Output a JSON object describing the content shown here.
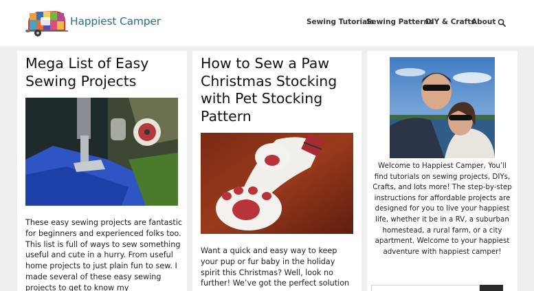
{
  "site": {
    "title": "Happiest Camper"
  },
  "nav": {
    "items": [
      "Sewing Tutorials",
      "Sewing Patterns",
      "DIY & Crafts",
      "About"
    ],
    "search_icon": "search-icon"
  },
  "posts": [
    {
      "title": "Mega List of Easy Sewing Projects",
      "excerpt": "These easy sewing projects are fantastic for beginners and experienced folks too. This list is full of ways to sew something useful and cute in a hurry. From useful home projects to just plain fun to sew. I made several of these easy sewing projects to get to know my"
    },
    {
      "title": "How to Sew a Paw Christmas Stocking with Pet Stocking Pattern",
      "excerpt": "Want a quick and easy way to keep your pup or fur baby in the holiday spirit this Christmas? Well, look no further! We’ve got the perfect solution"
    }
  ],
  "sidebar": {
    "bio": "Welcome to Happiest Camper, You’ll find tutorials on sewing projects, DIYs, Crafts, and lots more! The step-by-step instructions for affordable projects are designed for you to live your happiest life, whether it be in a RV, a suburban homestead, a rural farm, or a city apartment. Welcome to your happiest adventure with happiest camper!"
  },
  "colors": {
    "brand": "#2b6f86",
    "background": "#efefef",
    "search_button": "#2a2a2a"
  }
}
